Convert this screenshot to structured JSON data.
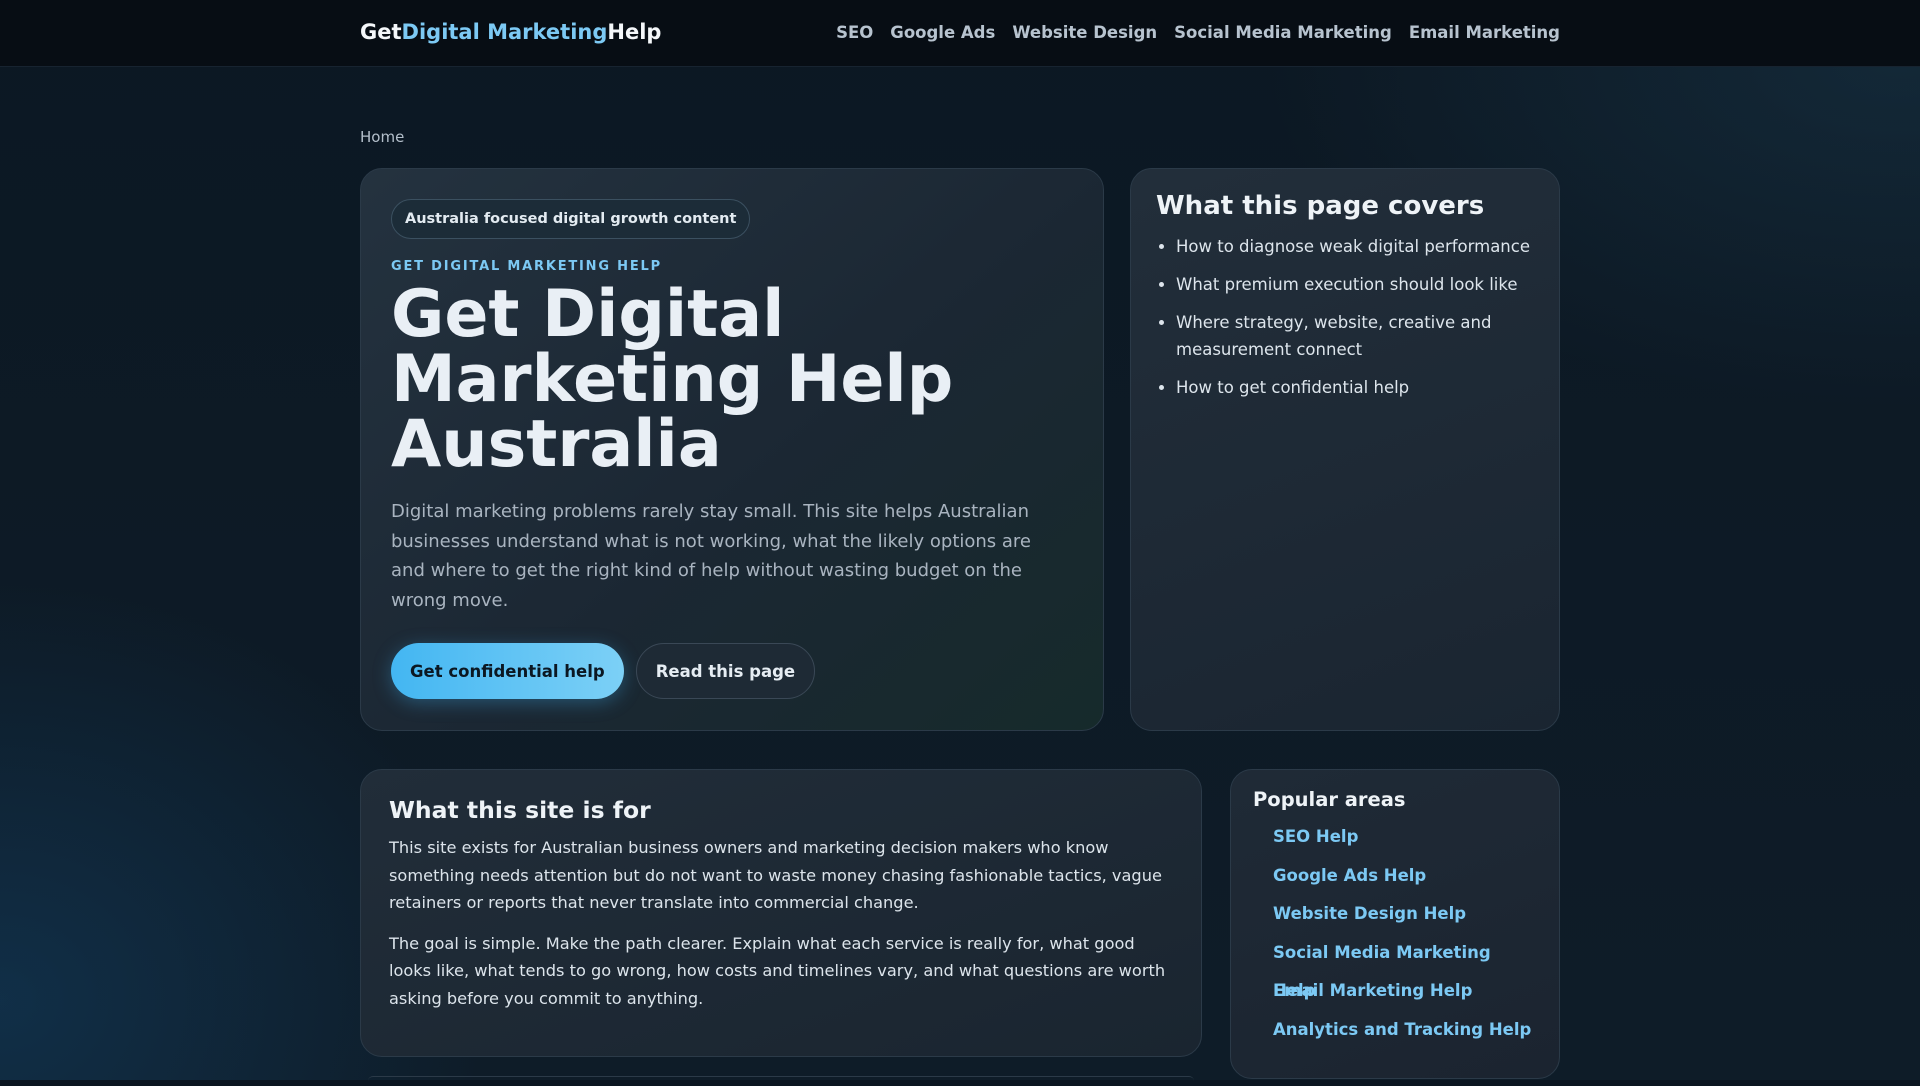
{
  "header": {
    "logo": {
      "part1": "Get",
      "part2": "Digital Marketing",
      "part3": "Help"
    },
    "nav": [
      "SEO",
      "Google Ads",
      "Website Design",
      "Social Media Marketing",
      "Email Marketing"
    ]
  },
  "breadcrumb": "Home",
  "hero": {
    "pill": "Australia focused digital growth content",
    "eyebrow": "GET DIGITAL MARKETING HELP",
    "title": "Get Digital Marketing Help Australia",
    "lede": "Digital marketing problems rarely stay small. This site helps Australian businesses understand what is not working, what the likely options are and where to get the right kind of help without wasting budget on the wrong move.",
    "primary_button": "Get confidential help",
    "secondary_button": "Read this page"
  },
  "covers": {
    "title": "What this page covers",
    "items": [
      "How to diagnose weak digital performance",
      "What premium execution should look like",
      "Where strategy, website, creative and measurement connect",
      "How to get confidential help"
    ]
  },
  "site_for": {
    "title": "What this site is for",
    "paragraphs": [
      "This site exists for Australian business owners and marketing decision makers who know something needs attention but do not want to waste money chasing fashionable tactics, vague retainers or reports that never translate into commercial change.",
      "The goal is simple. Make the path clearer. Explain what each service is really for, what good looks like, what tends to go wrong, how costs and timelines vary, and what questions are worth asking before you commit to anything."
    ]
  },
  "popular": {
    "title": "Popular areas",
    "links": [
      "SEO Help",
      "Google Ads Help",
      "Website Design Help",
      "Social Media Marketing Help",
      "Email Marketing Help",
      "Analytics and Tracking Help"
    ]
  }
}
